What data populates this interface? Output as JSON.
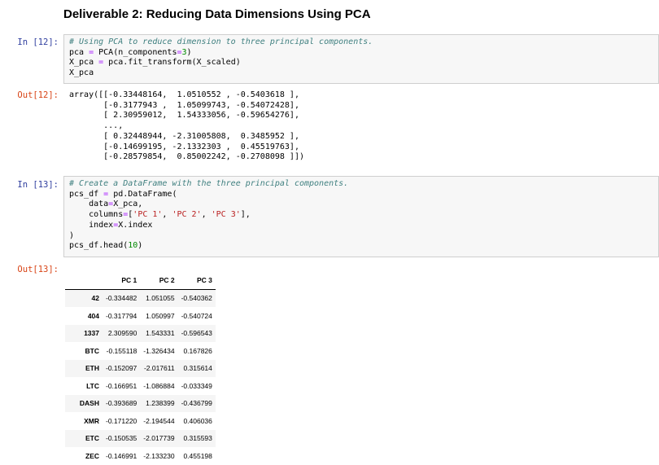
{
  "title": "Deliverable 2: Reducing Data Dimensions Using PCA",
  "cells": [
    {
      "in_prompt": "In [12]:",
      "out_prompt": "Out[12]:",
      "code": [
        [
          [
            "# Using PCA to reduce dimension to three principal components.",
            "cm"
          ]
        ],
        [
          [
            "pca ",
            ""
          ],
          [
            "=",
            "op"
          ],
          [
            " PCA(n_components",
            ""
          ],
          [
            "=",
            "op"
          ],
          [
            "3",
            "num"
          ],
          [
            ")",
            ""
          ]
        ],
        [
          [
            "X_pca ",
            ""
          ],
          [
            "=",
            "op"
          ],
          [
            " pca.fit_transform(X_scaled)",
            ""
          ]
        ],
        [
          [
            "X_pca",
            ""
          ]
        ]
      ],
      "output": [
        "array([[-0.33448164,  1.0510552 , -0.5403618 ],",
        "       [-0.3177943 ,  1.05099743, -0.54072428],",
        "       [ 2.30959012,  1.54333056, -0.59654276],",
        "       ...,",
        "       [ 0.32448944, -2.31005808,  0.3485952 ],",
        "       [-0.14699195, -2.1332303 ,  0.45519763],",
        "       [-0.28579854,  0.85002242, -0.2708098 ]])"
      ]
    },
    {
      "in_prompt": "In [13]:",
      "out_prompt": "Out[13]:",
      "code": [
        [
          [
            "# Create a DataFrame with the three principal components.",
            "cm"
          ]
        ],
        [
          [
            "pcs_df ",
            ""
          ],
          [
            "=",
            "op"
          ],
          [
            " pd.DataFrame(",
            ""
          ]
        ],
        [
          [
            "    data",
            ""
          ],
          [
            "=",
            "op"
          ],
          [
            "X_pca,",
            ""
          ]
        ],
        [
          [
            "    columns",
            ""
          ],
          [
            "=",
            "op"
          ],
          [
            "[",
            ""
          ],
          [
            "'PC 1'",
            "str"
          ],
          [
            ", ",
            ""
          ],
          [
            "'PC 2'",
            "str"
          ],
          [
            ", ",
            ""
          ],
          [
            "'PC 3'",
            "str"
          ],
          [
            "],",
            ""
          ]
        ],
        [
          [
            "    index",
            ""
          ],
          [
            "=",
            "op"
          ],
          [
            "X.index",
            ""
          ]
        ],
        [
          [
            ")",
            ""
          ]
        ],
        [
          [
            "pcs_df.head(",
            ""
          ],
          [
            "10",
            "num"
          ],
          [
            ")",
            ""
          ]
        ]
      ]
    }
  ],
  "table": {
    "columns": [
      "PC 1",
      "PC 2",
      "PC 3"
    ],
    "rows": [
      {
        "index": "42",
        "values": [
          "-0.334482",
          "1.051055",
          "-0.540362"
        ]
      },
      {
        "index": "404",
        "values": [
          "-0.317794",
          "1.050997",
          "-0.540724"
        ]
      },
      {
        "index": "1337",
        "values": [
          "2.309590",
          "1.543331",
          "-0.596543"
        ]
      },
      {
        "index": "BTC",
        "values": [
          "-0.155118",
          "-1.326434",
          "0.167826"
        ]
      },
      {
        "index": "ETH",
        "values": [
          "-0.152097",
          "-2.017611",
          "0.315614"
        ]
      },
      {
        "index": "LTC",
        "values": [
          "-0.166951",
          "-1.086884",
          "-0.033349"
        ]
      },
      {
        "index": "DASH",
        "values": [
          "-0.393689",
          "1.238399",
          "-0.436799"
        ]
      },
      {
        "index": "XMR",
        "values": [
          "-0.171220",
          "-2.194544",
          "0.406036"
        ]
      },
      {
        "index": "ETC",
        "values": [
          "-0.150535",
          "-2.017739",
          "0.315593"
        ]
      },
      {
        "index": "ZEC",
        "values": [
          "-0.146991",
          "-2.133230",
          "0.455198"
        ]
      }
    ]
  }
}
